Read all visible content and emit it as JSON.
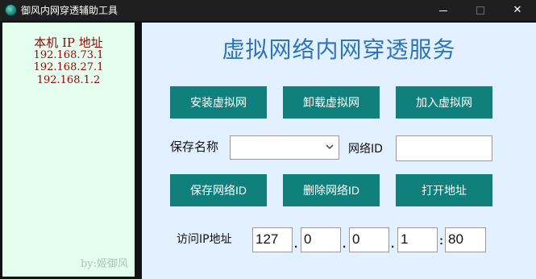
{
  "window": {
    "title": "御风内网穿透辅助工具",
    "icon": "globe-app-icon",
    "controls": {
      "minimize": "minimize",
      "maximize": "maximize",
      "close": "✕"
    }
  },
  "left_panel": {
    "title": "本机 IP 地址",
    "ip_addresses": [
      "192.168.73.1",
      "192.168.27.1",
      "192.168.1.2"
    ],
    "author": "by:姬御风",
    "colors": {
      "background": "#e4fff0",
      "text": "#a30000"
    }
  },
  "main": {
    "title": "虚拟网络内网穿透服务",
    "buttons": {
      "install": "安装虚拟网",
      "uninstall": "卸载虚拟网",
      "join": "加入虚拟网",
      "save_id": "保存网络ID",
      "delete_id": "删除网络ID",
      "open_address": "打开地址"
    },
    "save_name_label": "保存名称",
    "save_name_value": "",
    "network_id_label": "网络ID",
    "network_id_value": "",
    "access_ip_label": "访问IP地址",
    "ip_octets": [
      "127",
      "0",
      "0",
      "1"
    ],
    "ip_dot": ".",
    "port_sep": ":",
    "port": "80",
    "colors": {
      "background": "#e2f0ff",
      "title": "#2c74c0",
      "button": "#10807c",
      "button_text": "#ffffff"
    }
  }
}
